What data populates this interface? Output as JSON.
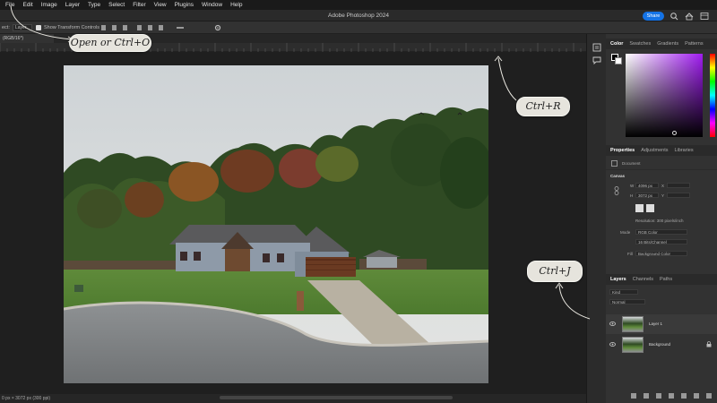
{
  "menu": [
    "File",
    "Edit",
    "Image",
    "Layer",
    "Type",
    "Select",
    "Filter",
    "View",
    "Plugins",
    "Window",
    "Help"
  ],
  "app_title": "Adobe Photoshop 2024",
  "share_label": "Share",
  "options": {
    "tool_prefix": "ect:",
    "layer_select": "Layer",
    "show_transform": "Show Transform Controls"
  },
  "doc_tab_label": "(RGB/16*)",
  "status_text": "0 px × 3072 px (300 ppi)",
  "color_panel_tabs": [
    "Color",
    "Swatches",
    "Gradients",
    "Patterns"
  ],
  "properties_tabs": [
    "Properties",
    "Adjustments",
    "Libraries"
  ],
  "properties": {
    "doc_label": "Document",
    "canvas_header": "Canvas",
    "width_label": "W",
    "width_value": "4096 px",
    "height_label": "H",
    "height_value": "3072 px",
    "x_label": "X",
    "y_label": "Y",
    "resolution": "Resolution: 300 pixels/inch",
    "mode_label": "Mode",
    "mode_value": "RGB Color",
    "bit_value": "16 Bits/Channel",
    "fill_label": "Fill",
    "fill_value": "Background Color"
  },
  "layers_tabs": [
    "Layers",
    "Channels",
    "Paths"
  ],
  "layers": {
    "kind_placeholder": "Kind",
    "blend_placeholder": "Normal",
    "items": [
      {
        "name": "Layer 1"
      },
      {
        "name": "Background"
      }
    ]
  },
  "annotations": {
    "open": "Open or Ctrl+O",
    "rulers": "Ctrl+R",
    "duplicate": "Ctrl+J"
  },
  "colors": {
    "accent": "#1473e6",
    "bubble": "#e6e4dd"
  }
}
